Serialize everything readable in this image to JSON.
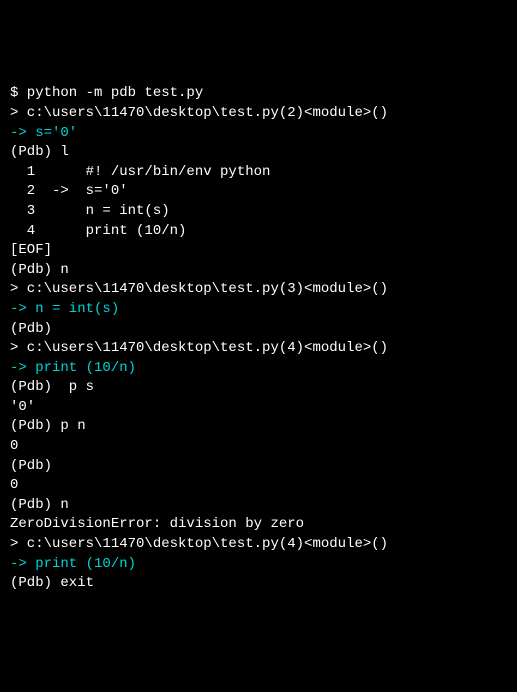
{
  "lines": [
    {
      "type": "plain",
      "text": "$ python -m pdb test.py"
    },
    {
      "type": "plain",
      "text": "> c:\\users\\11470\\desktop\\test.py(2)<module>()"
    },
    {
      "type": "cyan",
      "text": "-> s='0'"
    },
    {
      "type": "plain",
      "text": "(Pdb) l"
    },
    {
      "type": "plain",
      "text": "  1      #! /usr/bin/env python"
    },
    {
      "type": "plain",
      "text": "  2  ->  s='0'"
    },
    {
      "type": "plain",
      "text": "  3      n = int(s)"
    },
    {
      "type": "plain",
      "text": "  4      print (10/n)"
    },
    {
      "type": "plain",
      "text": "[EOF]"
    },
    {
      "type": "plain",
      "text": "(Pdb) n"
    },
    {
      "type": "plain",
      "text": "> c:\\users\\11470\\desktop\\test.py(3)<module>()"
    },
    {
      "type": "cyan",
      "text": "-> n = int(s)"
    },
    {
      "type": "plain",
      "text": "(Pdb)"
    },
    {
      "type": "plain",
      "text": "> c:\\users\\11470\\desktop\\test.py(4)<module>()"
    },
    {
      "type": "cyan",
      "text": "-> print (10/n)"
    },
    {
      "type": "plain",
      "text": "(Pdb)  p s"
    },
    {
      "type": "plain",
      "text": "'0'"
    },
    {
      "type": "plain",
      "text": "(Pdb) p n"
    },
    {
      "type": "plain",
      "text": "0"
    },
    {
      "type": "plain",
      "text": "(Pdb)"
    },
    {
      "type": "plain",
      "text": "0"
    },
    {
      "type": "plain",
      "text": "(Pdb) n"
    },
    {
      "type": "plain",
      "text": "ZeroDivisionError: division by zero"
    },
    {
      "type": "plain",
      "text": "> c:\\users\\11470\\desktop\\test.py(4)<module>()"
    },
    {
      "type": "cyan",
      "text": "-> print (10/n)"
    },
    {
      "type": "plain",
      "text": "(Pdb) exit"
    }
  ]
}
